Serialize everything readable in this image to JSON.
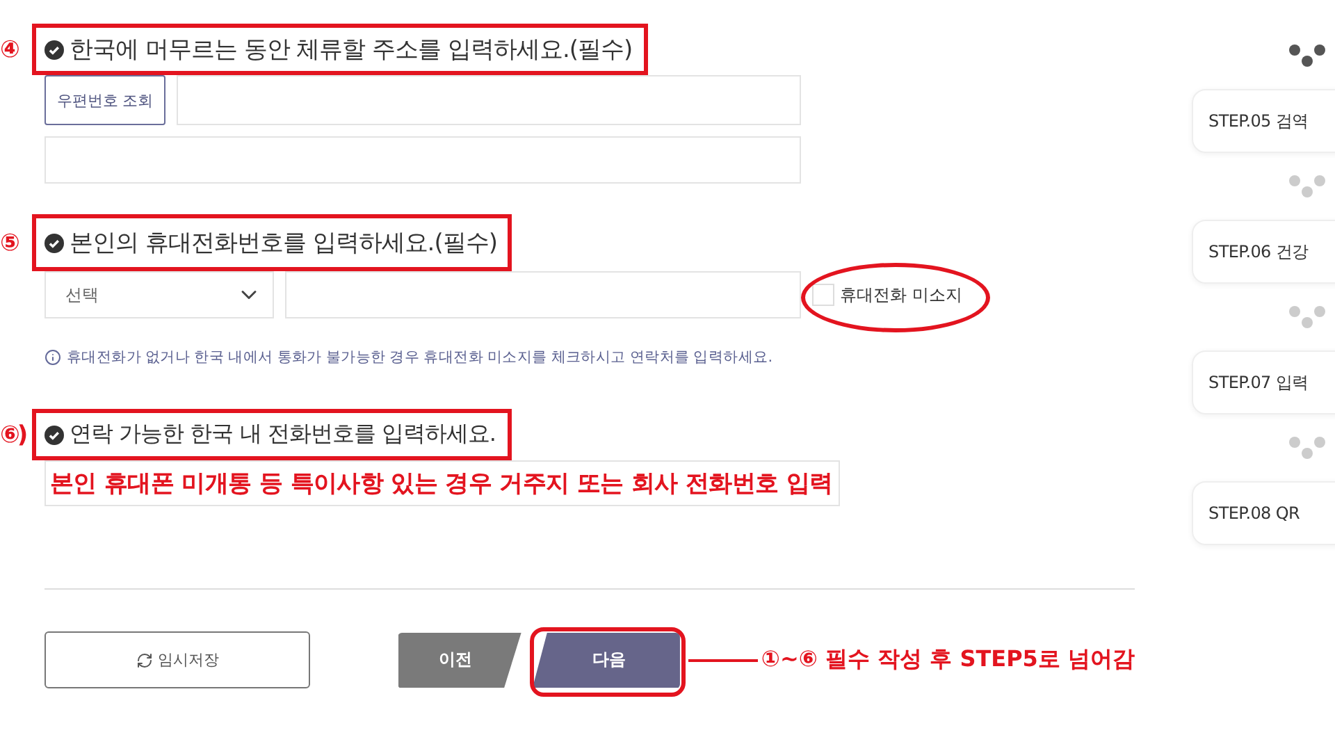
{
  "sections": [
    {
      "kind": "address",
      "marker": "④",
      "title": "한국에 머무르는 동안 체류할 주소를 입력하세요.(필수)",
      "highlighted": true,
      "button": "우편번호 조회"
    },
    {
      "kind": "mobile",
      "marker": "⑤",
      "title": "본인의 휴대전화번호를 입력하세요.(필수)",
      "highlighted": true,
      "select": "선택",
      "checkbox": {
        "label": "휴대전화 미소지",
        "checked": false,
        "circled": true
      },
      "info": "휴대전화가 없거나 한국 내에서 통화가 불가능한 경우 휴대전화 미소지를 체크하시고 연락처를 입력하세요."
    },
    {
      "kind": "phone",
      "marker": "⑥)",
      "title": "연락 가능한 한국 내 전화번호를 입력하세요.",
      "highlighted": true,
      "note": "본인 휴대폰 미개통 등 특이사항 있는 경우 거주지 또는 회사 전화번호 입력"
    }
  ],
  "actions": {
    "save": "임시저장",
    "prev": "이전",
    "next": "다음",
    "next_circled": true,
    "callout": "①~⑥ 필수 작성 후 STEP5로 넘어감"
  },
  "steps": [
    {
      "label": "STEP.05 검역",
      "connector_active": true
    },
    {
      "label": "STEP.06 건강",
      "connector_active": false
    },
    {
      "label": "STEP.07 입력",
      "connector_active": false
    },
    {
      "label": "STEP.08 QR",
      "connector_active": false
    }
  ]
}
